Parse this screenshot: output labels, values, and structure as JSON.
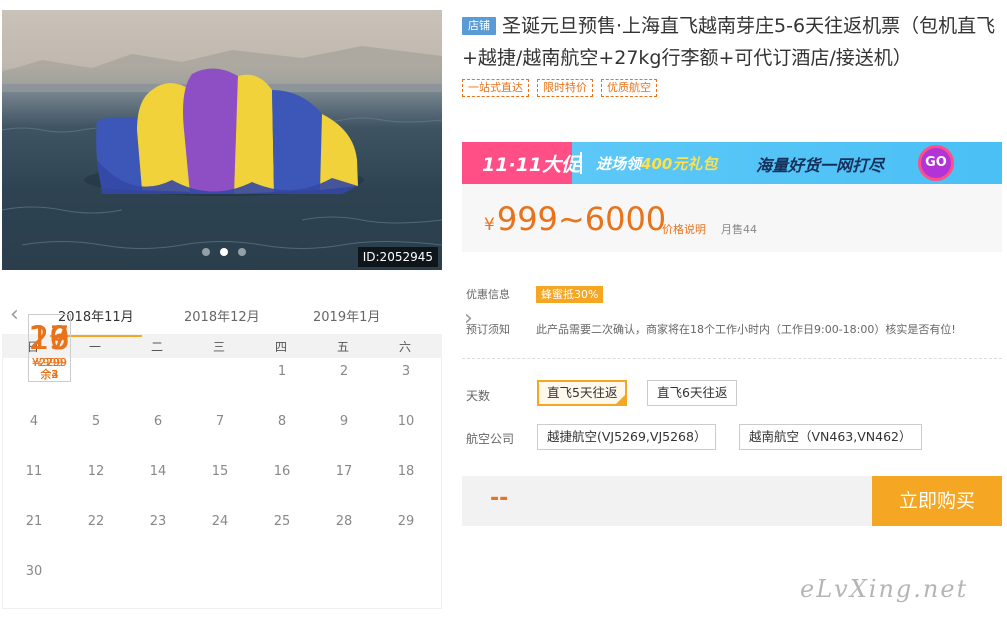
{
  "hero": {
    "id_label": "ID:2052945"
  },
  "calendar": {
    "months": [
      "2018年11月",
      "2018年12月",
      "2019年1月"
    ],
    "weekdays": [
      "日",
      "一",
      "二",
      "三",
      "四",
      "五",
      "六"
    ],
    "week1": [
      "",
      "",
      "",
      "",
      "1",
      "2",
      "3"
    ],
    "week2": [
      "4",
      "5",
      "6",
      "7",
      "8",
      "9",
      "10"
    ],
    "week3": [
      {
        "d": "11"
      },
      {
        "d": "12"
      },
      {
        "d": "13",
        "p": "¥2299",
        "r": "余3"
      },
      {
        "d": "14"
      },
      {
        "d": "15"
      },
      {
        "d": "16"
      },
      {
        "d": "17"
      }
    ],
    "week4": [
      {
        "d": "18"
      },
      {
        "d": "19",
        "p": "¥999",
        "r": "余4"
      },
      {
        "d": "20",
        "p": "¥2299",
        "r": "余3"
      },
      {
        "d": "21"
      },
      {
        "d": "22"
      },
      {
        "d": "23"
      },
      {
        "d": "24"
      }
    ],
    "week5": [
      {
        "d": "25"
      },
      {
        "d": "26",
        "p": "¥2799",
        "r": "余2"
      },
      {
        "d": "27",
        "p": "¥2299",
        "r": "余3"
      },
      {
        "d": "28"
      },
      {
        "d": "29"
      },
      {
        "d": "30"
      },
      {
        "d": ""
      }
    ]
  },
  "product": {
    "store_tag": "店铺",
    "title": "圣诞元旦预售·上海直飞越南芽庄5-6天往返机票（包机直飞+越捷/越南航空+27kg行李额+可代订酒店/接送机）",
    "tags": [
      "一站式直达",
      "限时特价",
      "优质航空"
    ]
  },
  "banner": {
    "event": "11·11大促",
    "promo_prefix": "进场领",
    "promo_highlight": "400元礼包",
    "slogan": "海量好货一网打尽",
    "go": "GO"
  },
  "price": {
    "currency": "¥",
    "range": "999~6000",
    "note": "价格说明",
    "sales": "月售44"
  },
  "info": {
    "discount_label": "优惠信息",
    "discount_badge": "蜂蜜抵30%",
    "booking_label": "预订须知",
    "booking_text": "此产品需要二次确认，商家将在18个工作小时内（工作日9:00-18:00）核实是否有位!"
  },
  "options": {
    "days_label": "天数",
    "days": [
      "直飞5天往返",
      "直飞6天往返"
    ],
    "airline_label": "航空公司",
    "airlines": [
      "越捷航空(VJ5269,VJ5268）",
      "越南航空（VN463,VN462）"
    ]
  },
  "buy": {
    "price_placeholder": "--",
    "button": "立即购买"
  },
  "watermark": "eLvXing.net",
  "colors": {
    "accent": "#f5a623",
    "price": "#e8731a",
    "store_tag": "#5b9bd5"
  }
}
